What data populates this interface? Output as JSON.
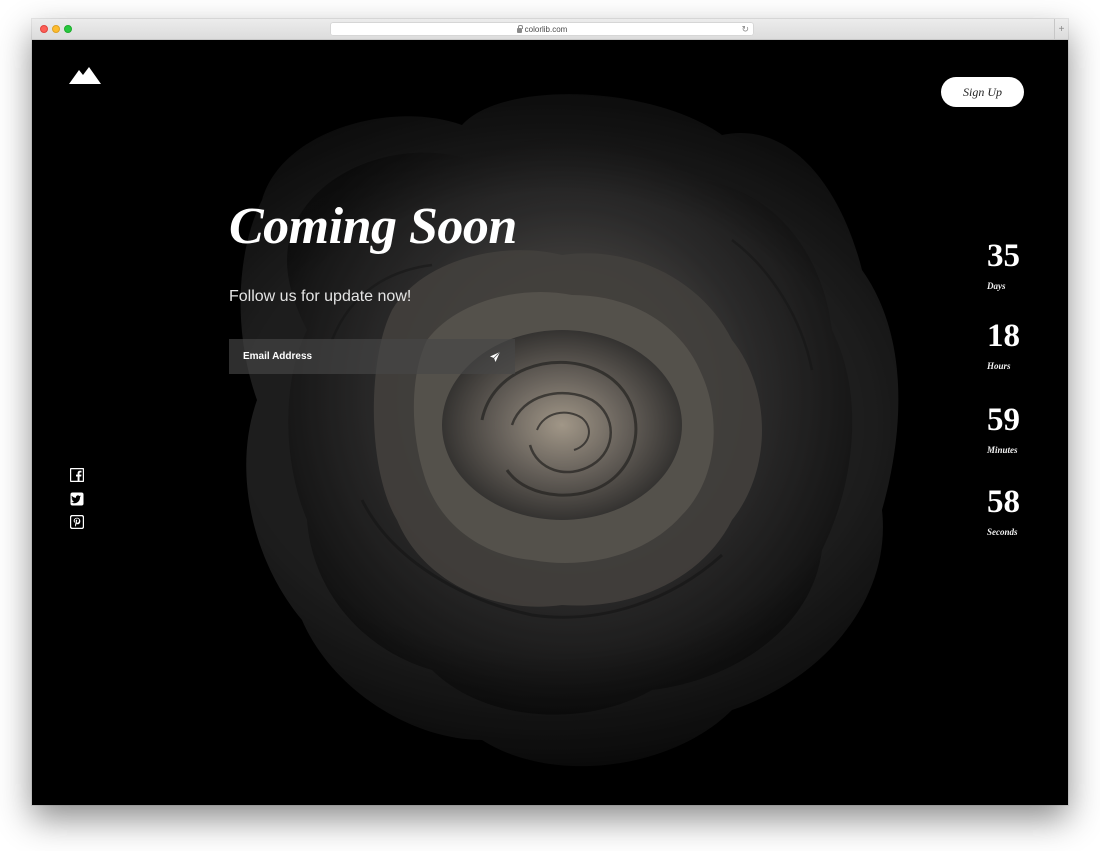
{
  "browser": {
    "url": "colorlib.com"
  },
  "header": {
    "logo_icon": "mountain-icon",
    "signup_label": "Sign Up"
  },
  "hero": {
    "title": "Coming Soon",
    "subtitle": "Follow us for update now!",
    "email_placeholder": "Email Address",
    "send_icon": "paper-plane-icon"
  },
  "social": [
    {
      "icon": "facebook-icon"
    },
    {
      "icon": "twitter-icon"
    },
    {
      "icon": "pinterest-icon"
    }
  ],
  "countdown": [
    {
      "value": "35",
      "label": "Days"
    },
    {
      "value": "18",
      "label": "Hours"
    },
    {
      "value": "59",
      "label": "Minutes"
    },
    {
      "value": "58",
      "label": "Seconds"
    }
  ],
  "colors": {
    "background": "#000000",
    "text": "#ffffff",
    "button_bg": "#ffffff"
  }
}
